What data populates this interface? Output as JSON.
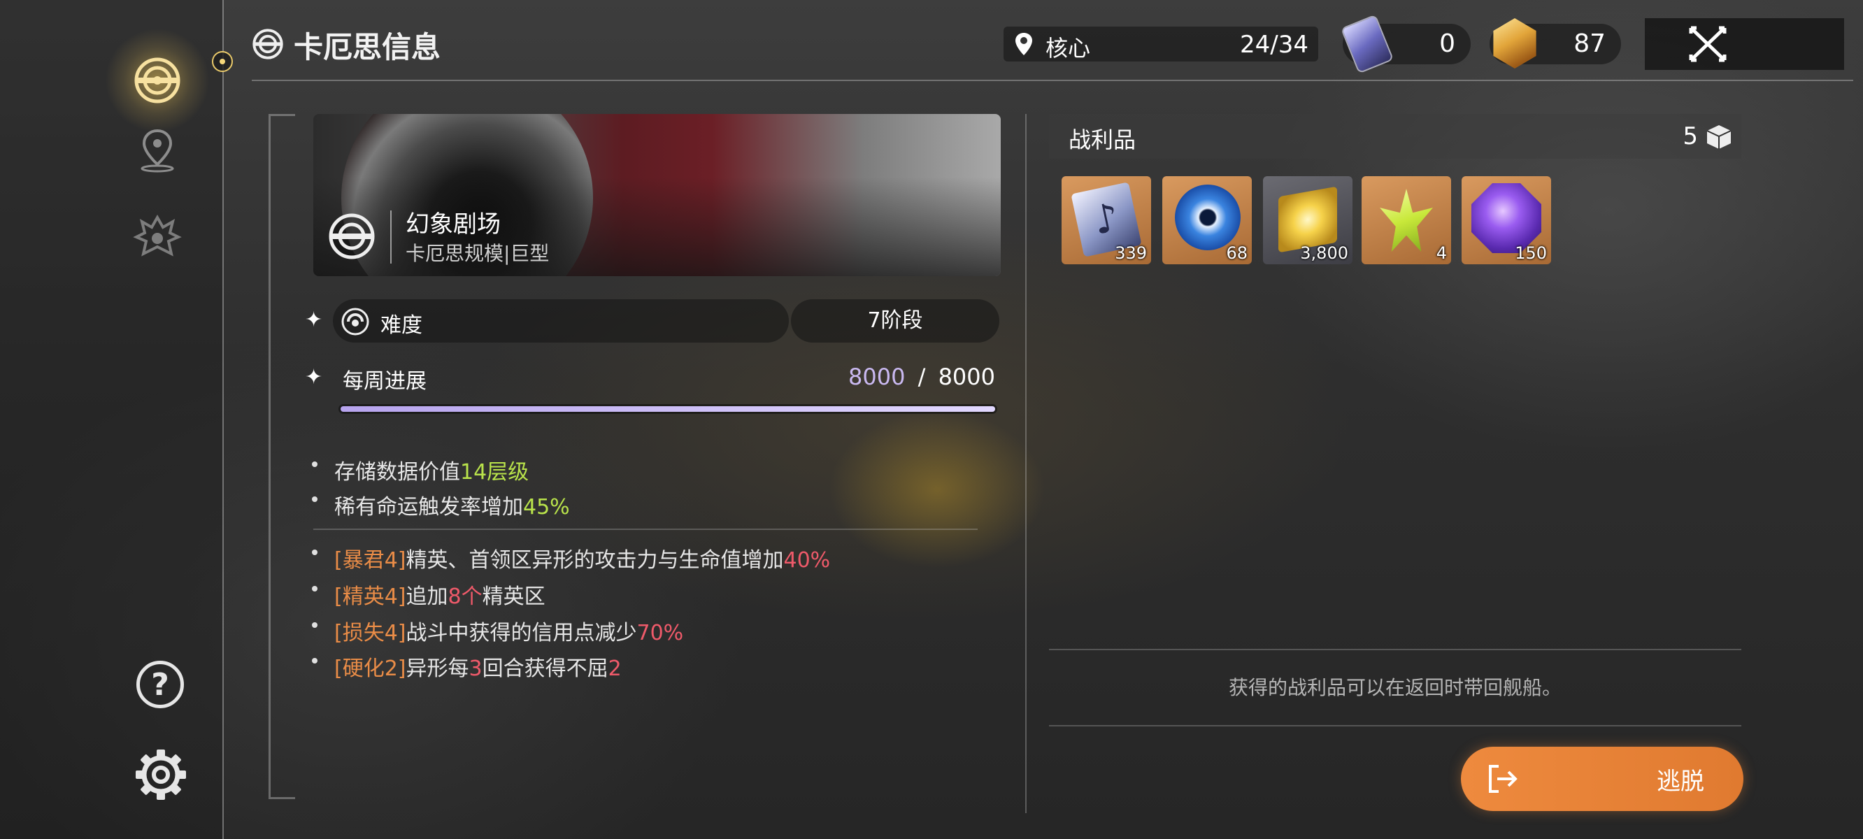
{
  "header": {
    "title": "卡厄思信息",
    "location_label": "核心",
    "location_progress": "24/34",
    "currency1": "0",
    "currency2": "87"
  },
  "banner": {
    "title": "幻象剧场",
    "subtitle": "卡厄思规模|巨型"
  },
  "difficulty": {
    "label": "难度",
    "value": "7阶段"
  },
  "weekly": {
    "label": "每周进展",
    "current": "8000",
    "separator": "/",
    "max": "8000",
    "progress": 1.0
  },
  "bonuses": [
    {
      "prefix": "存储数据价值",
      "value": "14层级"
    },
    {
      "prefix": "稀有命运触发率增加",
      "value": "45%"
    }
  ],
  "modifiers": [
    {
      "tag": "[暴君4]",
      "text": "精英、首领区异形的攻击力与生命值增加",
      "value": "40%",
      "text2": "",
      "value2": ""
    },
    {
      "tag": "[精英4]",
      "text": "追加",
      "value": "8个",
      "text2": "精英区",
      "value2": ""
    },
    {
      "tag": "[损失4]",
      "text": "战斗中获得的信用点减少",
      "value": "70%",
      "text2": "",
      "value2": ""
    },
    {
      "tag": "[硬化2]",
      "text": "异形每",
      "value": "3",
      "text2": "回合获得不屈",
      "value2": "2"
    }
  ],
  "loot": {
    "title": "战利品",
    "count": "5",
    "items": [
      "339",
      "68",
      "3,800",
      "4",
      "150"
    ],
    "note": "获得的战利品可以在返回时带回舰船。"
  },
  "escape_button": "逃脱",
  "colors": {
    "accent_orange": "#e9823a",
    "highlight_green": "#b9e34b",
    "highlight_red": "#ef5a6a",
    "tag_orange": "#e98c47",
    "progress_purple": "#c9b8f0"
  }
}
